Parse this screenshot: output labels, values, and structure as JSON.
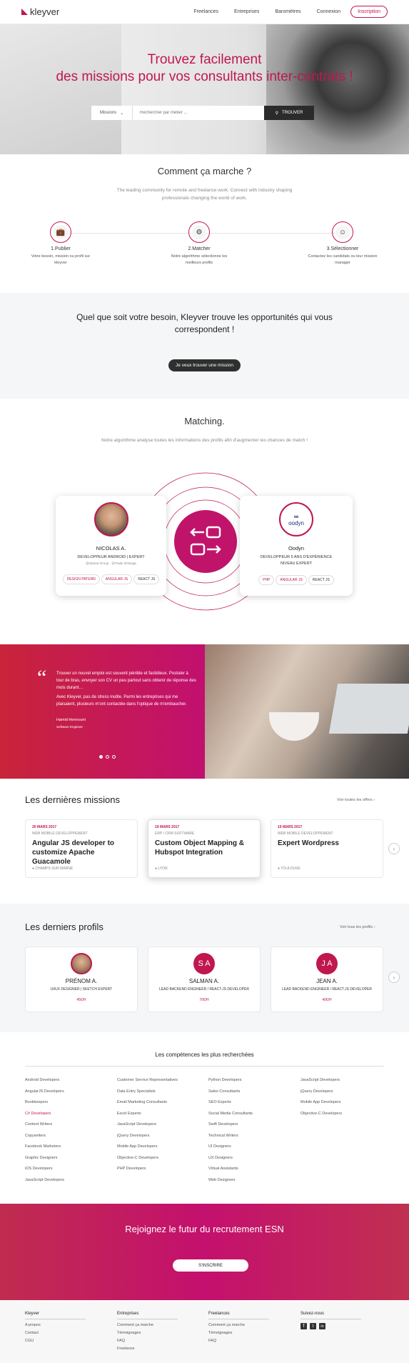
{
  "header": {
    "logo": "kleyver",
    "nav": [
      "Freelances",
      "Entreprises",
      "Baromètres",
      "Connexion"
    ],
    "signup": "Inscription"
  },
  "hero": {
    "line1": "Trouvez facilement",
    "line2": "des missions pour vos consultants inter-contrats !",
    "select": "Missions",
    "placeholder": "Rechercher par métier ...",
    "search_btn": "TROUVER"
  },
  "how": {
    "title": "Comment ça marche ?",
    "subtitle": "The leading community for remote and freelance work. Connect with industry shaping professionals changing the world of work.",
    "steps": [
      {
        "title": "1.Publier",
        "desc": "Votre besoin, mission ou profil sur kleyver"
      },
      {
        "title": "2.Matcher",
        "desc": "Notre algorithme sélectionne les meilleurs profils"
      },
      {
        "title": "3.Sélectionner",
        "desc": "Contactez les candidats ou leur mission manager"
      }
    ]
  },
  "promo": {
    "title": "Quel que soit votre besoin, Kleyver trouve les opportunités qui vous correspondent !",
    "button": "Je veux trouver une mission"
  },
  "matching": {
    "title": "Matching.",
    "subtitle": "Notre algorithme analyse toutes les informations des profils afin d'augmenter les chances de match !",
    "left": {
      "name": "NICOLAS A.",
      "role": "DEVELOPPEUR ANDROID | EXPERT",
      "extra": "@Optical Group · @Trade dchange",
      "tags": [
        "DESIGN PATERN",
        "ANGULAR JS",
        "REACT JS"
      ]
    },
    "right": {
      "logo": "oodyn",
      "name": "Oodyn",
      "role": "DEVELOPPEUR 5 ANS D'EXPÉRIENCE",
      "level": "NIVEAU EXPERT",
      "tags": [
        "PHP",
        "ANGULAR JS",
        "REACT JS"
      ]
    }
  },
  "testimonial": {
    "quote_mark": "“",
    "p1": "Trouver un nouvel emploi est souvent pénible et fastidieux. Postuler à tour de bras, envoyer son CV un peu partout sans obtenir de réponse des mois durant…",
    "p2": "Avec Kleyver, pas de stress inutile. Parmi les entreprises qui me plaisaient, plusieurs m'ont contactée dans l'optique de m'embaucher.",
    "name": "Hamid Hennouni",
    "role": "Software Engineer"
  },
  "missions": {
    "title": "Les dernières missions",
    "link": "Voir toutes les offres",
    "items": [
      {
        "date": "20 MARS 2017",
        "cat": "WEB MOBILE DEVELOPPEMENT",
        "title": "Angular JS developer to customize Apache Guacamole",
        "loc": "CHAMPS SUR MARNE"
      },
      {
        "date": "19 MARS 2017",
        "cat": "ERP / CRM SOFTWARE",
        "title": "Custom Object Mapping & Hubspot Integration",
        "loc": "LYON"
      },
      {
        "date": "19 MARS 2017",
        "cat": "WEB MOBILE DEVELOPPEMENT",
        "title": "Expert Wordpress",
        "loc": "TOULOUSE"
      }
    ]
  },
  "profiles": {
    "title": "Les derniers profils",
    "link": "Voir tous les profils",
    "items": [
      {
        "initials": "",
        "name": "PRÉNOM A.",
        "role": "UI/UX DESIGNER | SKETCH EXPERT",
        "price": "45€/H"
      },
      {
        "initials": "S A",
        "name": "SALMAN A.",
        "role": "LEAD BACKEND ENGINEER / REACT.JS DEVELOPER",
        "price": "70€/H"
      },
      {
        "initials": "J A",
        "name": "JEAN A.",
        "role": "LEAD BACKEND ENGINEER / REACT.JS DEVELOPER",
        "price": "40€/H"
      }
    ]
  },
  "skills": {
    "title": "Les compétences les plus recherchées",
    "cols": [
      [
        "Android Developers",
        "AngularJS Developers",
        "Bookkeepers",
        "C# Developers",
        "Content Writers",
        "Copywriters",
        "Facebook Marketers",
        "Graphic Designers",
        "iOS Developers",
        "JavaScript Developers"
      ],
      [
        "Customer Service Representatives",
        "Data Entry Specialists",
        "Email Marketing Consultants",
        "Excel Experts",
        "JavaScript Developers",
        "jQuery Developers",
        "Mobile App Developers",
        "Objective-C Developers",
        "PHP Developers"
      ],
      [
        "Python Developers",
        "Sales Consultants",
        "SEO Experts",
        "Social Media Consultants",
        "Swift Developers",
        "Technical Writers",
        "UI Designers",
        "UX Designers",
        "Virtual Assistants",
        "Web Designers"
      ],
      [
        "JavaScript Developers",
        "jQuery Developers",
        "Mobile App Developers",
        "Objective-C Developers"
      ]
    ]
  },
  "cta": {
    "title": "Rejoignez le futur du recrutement ESN",
    "button": "S'INSCRIRE"
  },
  "footer": {
    "cols": [
      {
        "head": "Kleyver",
        "links": [
          "A propos",
          "Contact",
          "CGU"
        ]
      },
      {
        "head": "Entreprises",
        "links": [
          "Comment ça marche",
          "Témoignages",
          "FAQ",
          "Freelance"
        ]
      },
      {
        "head": "Freelances",
        "links": [
          "Comment ça marche",
          "Témoignages",
          "FAQ"
        ]
      },
      {
        "head": "Suivez-nous",
        "links": []
      }
    ]
  },
  "colors": {
    "accent": "#c0174f",
    "dark": "#2b2b2b"
  }
}
